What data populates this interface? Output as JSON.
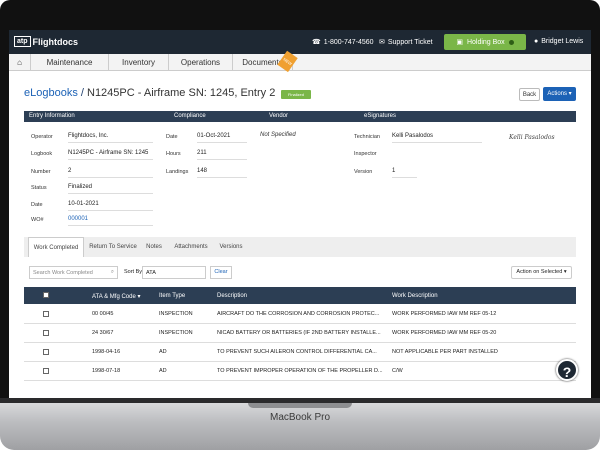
{
  "device": {
    "label": "MacBook Pro"
  },
  "header": {
    "logo_badge": "atp",
    "logo_text": "Flightdocs",
    "phone": "1-800-747-4560",
    "support": "Support Ticket",
    "holding_box": "Holding Box",
    "user": "Bridget Lewis"
  },
  "nav": {
    "items": [
      "Maintenance",
      "Inventory",
      "Operations",
      "Documents"
    ],
    "documents_badge": "NEW"
  },
  "page": {
    "breadcrumb_root": "eLogbooks",
    "breadcrumb_sep": " / ",
    "breadcrumb_title": "N1245PC - Airframe SN: 1245, Entry 2",
    "status_badge": "Finalized",
    "back": "Back",
    "actions": "Actions ▾"
  },
  "sections": {
    "entry_info": "Entry Information",
    "compliance": "Compliance",
    "vendor": "Vendor",
    "esignatures": "eSignatures"
  },
  "entry": {
    "operator_label": "Operator",
    "operator": "Flightdocs, Inc.",
    "logbook_label": "Logbook",
    "logbook": "N1245PC - Airframe SN: 1245",
    "number_label": "Number",
    "number": "2",
    "status_label": "Status",
    "status": "Finalized",
    "date_label": "Date",
    "date": "10-01-2021",
    "wo_label": "WO#",
    "wo": "000001"
  },
  "compliance": {
    "date_label": "Date",
    "date": "01-Oct-2021",
    "hours_label": "Hours",
    "hours": "211",
    "landings_label": "Landings",
    "landings": "148"
  },
  "vendor": {
    "value": "Not Specified"
  },
  "esig": {
    "technician_label": "Technician",
    "technician": "Kelli Pasalodos",
    "inspector_label": "Inspector",
    "version_label": "Version",
    "version": "1",
    "signature": "Kelli Pasalodos"
  },
  "tabs": [
    "Work Completed",
    "Return To Service",
    "Notes",
    "Attachments",
    "Versions"
  ],
  "toolbar": {
    "search_placeholder": "Search Work Completed",
    "sort_label": "Sort By",
    "sort_value": "ATA",
    "clear": "Clear",
    "action_selected": "Action on Selected ▾"
  },
  "table": {
    "columns": [
      "ATA & Mfg Code ▾",
      "Item Type",
      "Description",
      "Work Description"
    ],
    "rows": [
      [
        "00 00/45",
        "INSPECTION",
        "AIRCRAFT DO THE CORROSION AND CORROSION PROTEC...",
        "WORK PERFORMED IAW MM REF 05-12"
      ],
      [
        "24 30/67",
        "INSPECTION",
        "NICAD BATTERY OR BATTERIES (IF 2ND BATTERY INSTALLE...",
        "WORK PERFORMED IAW MM REF 05-20"
      ],
      [
        "1998-04-16",
        "AD",
        "TO PREVENT SUCH AILERON CONTROL DIFFERENTIAL CA...",
        "NOT APPLICABLE PER PART INSTALLED"
      ],
      [
        "1998-07-18",
        "AD",
        "TO PREVENT IMPROPER OPERATION OF THE PROPELLER D...",
        "C/W"
      ]
    ]
  },
  "help": "?"
}
